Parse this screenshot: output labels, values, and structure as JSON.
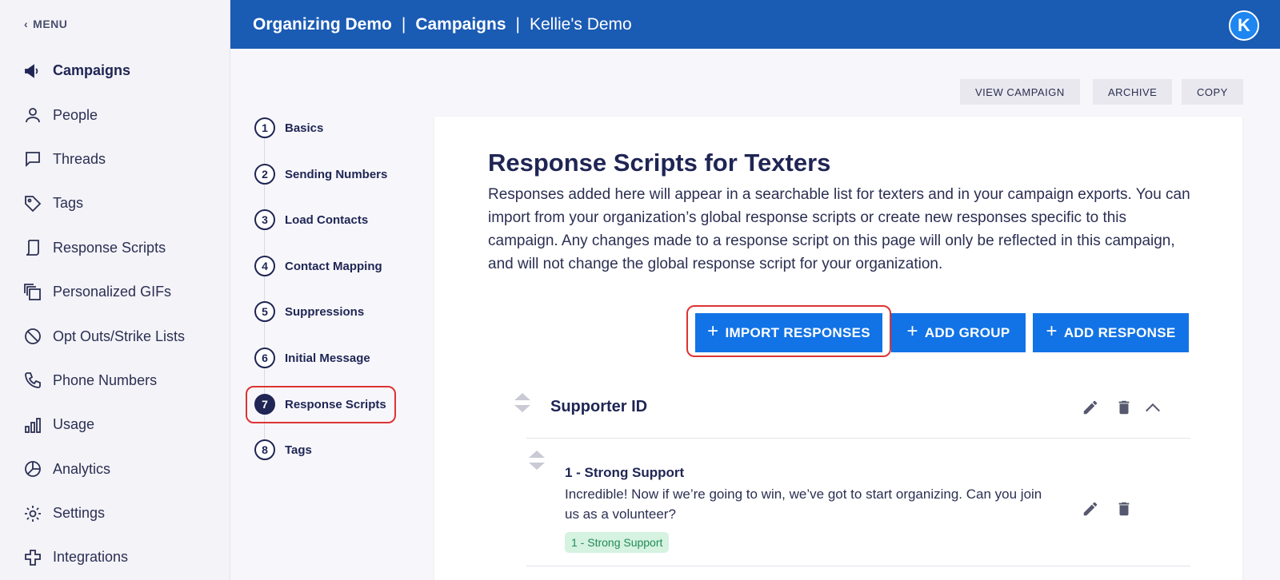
{
  "sidebar": {
    "menu_label": "MENU",
    "items": [
      {
        "label": "Campaigns",
        "icon": "megaphone-icon",
        "active": true
      },
      {
        "label": "People",
        "icon": "person-icon"
      },
      {
        "label": "Threads",
        "icon": "chat-bubble-icon"
      },
      {
        "label": "Tags",
        "icon": "tag-icon"
      },
      {
        "label": "Response Scripts",
        "icon": "script-icon"
      },
      {
        "label": "Personalized GIFs",
        "icon": "gif-stack-icon"
      },
      {
        "label": "Opt Outs/Strike Lists",
        "icon": "block-icon"
      },
      {
        "label": "Phone Numbers",
        "icon": "phone-icon"
      },
      {
        "label": "Usage",
        "icon": "bar-chart-icon"
      },
      {
        "label": "Analytics",
        "icon": "pie-chart-icon"
      },
      {
        "label": "Settings",
        "icon": "gear-icon"
      },
      {
        "label": "Integrations",
        "icon": "puzzle-icon"
      }
    ]
  },
  "header": {
    "org": "Organizing Demo",
    "section": "Campaigns",
    "campaign": "Kellie's Demo",
    "avatar_letter": "K",
    "color": "#1a5bb4"
  },
  "top_actions": {
    "view_campaign": "VIEW CAMPAIGN",
    "archive": "ARCHIVE",
    "copy": "COPY"
  },
  "steps": [
    {
      "num": "1",
      "label": "Basics"
    },
    {
      "num": "2",
      "label": "Sending Numbers"
    },
    {
      "num": "3",
      "label": "Load Contacts"
    },
    {
      "num": "4",
      "label": "Contact Mapping"
    },
    {
      "num": "5",
      "label": "Suppressions"
    },
    {
      "num": "6",
      "label": "Initial Message"
    },
    {
      "num": "7",
      "label": "Response Scripts",
      "active": true
    },
    {
      "num": "8",
      "label": "Tags"
    }
  ],
  "main": {
    "title": "Response Scripts for Texters",
    "description": "Responses added here will appear in a searchable list for texters and in your campaign exports. You can import from your organization’s global response scripts or create new responses specific to this campaign. Any changes made to a response script on this page will only be reflected in this campaign, and will not change the global response script for your organization.",
    "buttons": {
      "import": "IMPORT RESPONSES",
      "add_group": "ADD GROUP",
      "add_response": "ADD RESPONSE"
    },
    "group": {
      "title": "Supporter ID",
      "responses": [
        {
          "title": "1 - Strong Support",
          "text": "Incredible! Now if we’re going to win, we’ve got to start organizing. Can you join us as a volunteer?",
          "tag": "1 - Strong Support"
        }
      ]
    }
  },
  "colors": {
    "primary": "#1273e6",
    "navy": "#1f2554",
    "highlight": "#dd3333",
    "tag_bg": "#d6f2e1",
    "tag_text": "#1f8c55"
  }
}
